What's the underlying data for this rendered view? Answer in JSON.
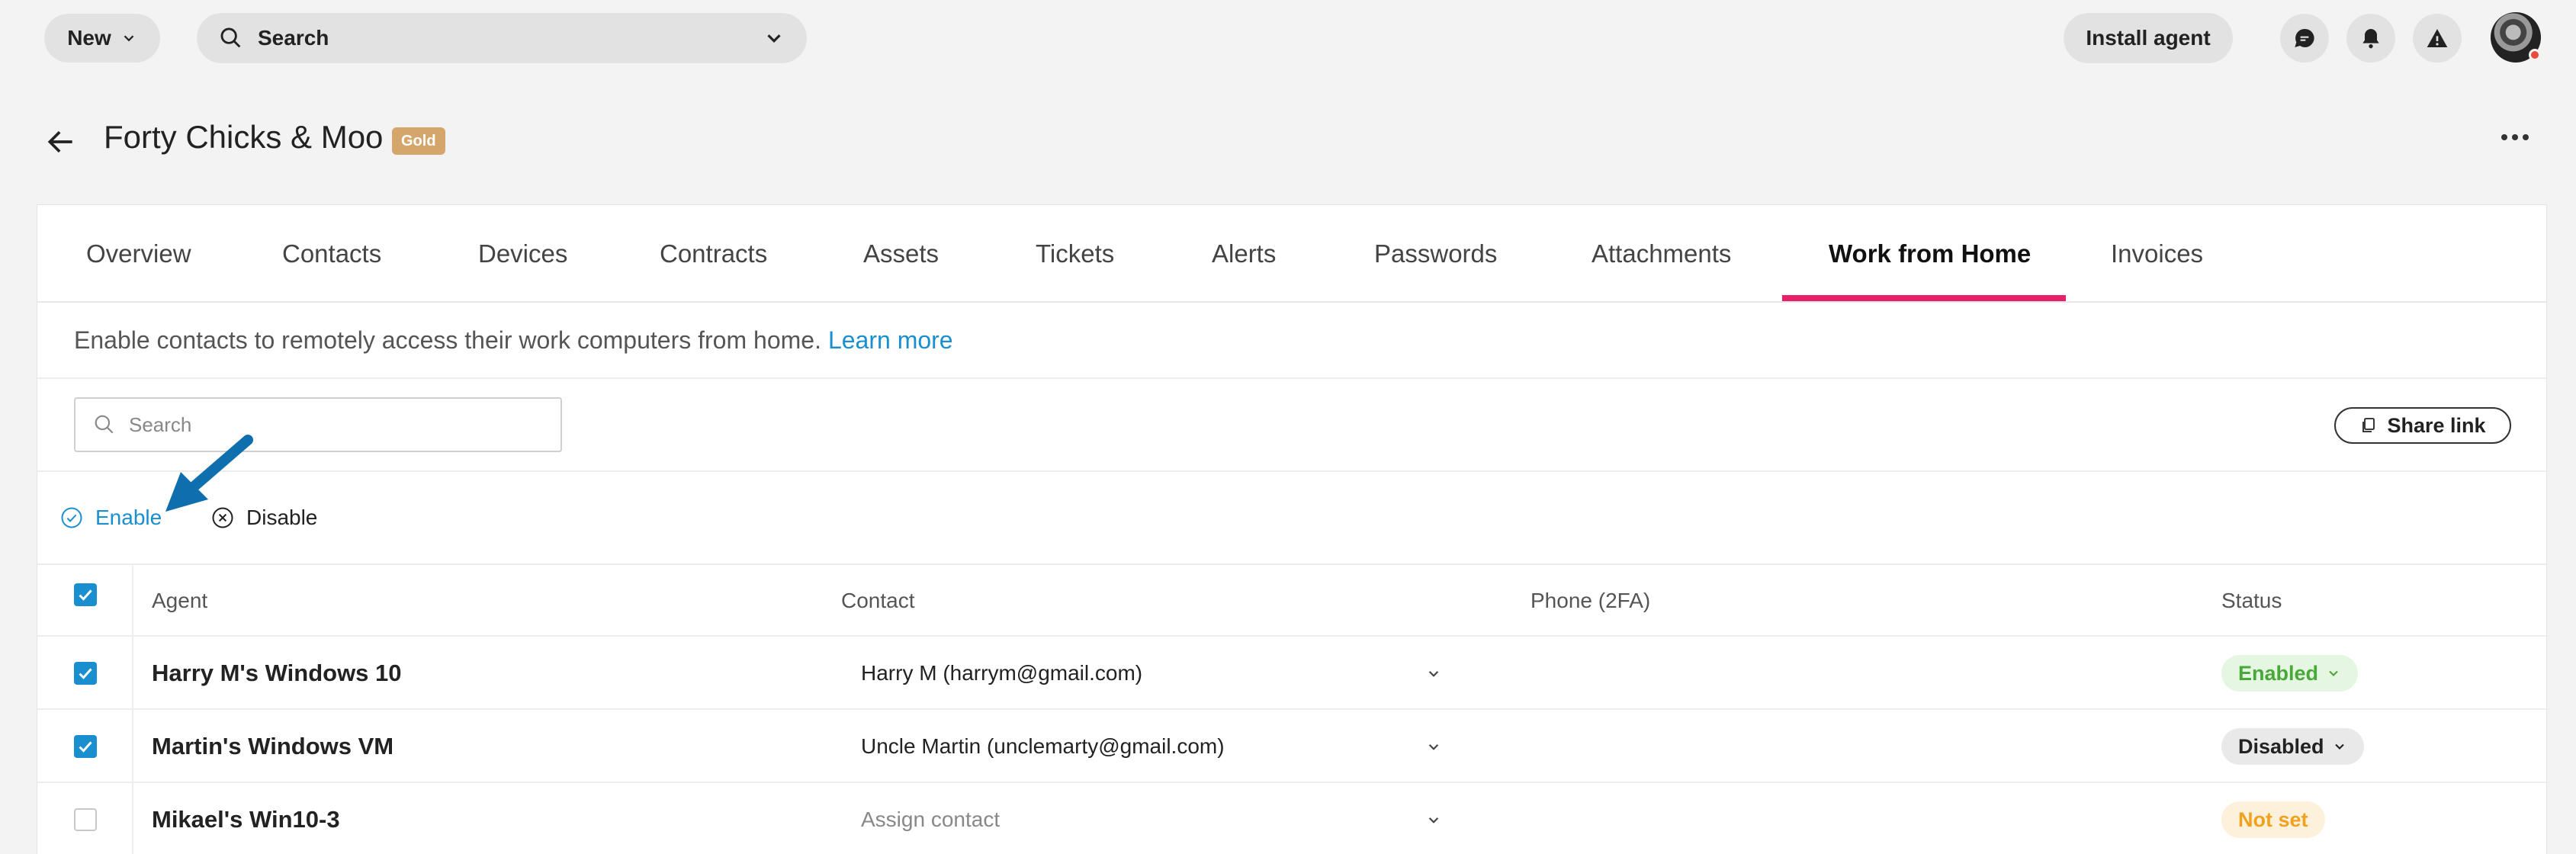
{
  "topbar": {
    "new_label": "New",
    "search_label": "Search",
    "install_label": "Install agent",
    "icons": [
      "chat-icon",
      "bell-icon",
      "warning-icon"
    ]
  },
  "page": {
    "title": "Forty Chicks & Moo",
    "badge": "Gold"
  },
  "tabs": [
    {
      "label": "Overview"
    },
    {
      "label": "Contacts"
    },
    {
      "label": "Devices"
    },
    {
      "label": "Contracts"
    },
    {
      "label": "Assets"
    },
    {
      "label": "Tickets"
    },
    {
      "label": "Alerts"
    },
    {
      "label": "Passwords"
    },
    {
      "label": "Attachments"
    },
    {
      "label": "Work from Home",
      "active": true
    },
    {
      "label": "Invoices"
    }
  ],
  "info": {
    "text": "Enable contacts to remotely access their work computers from home.",
    "link": "Learn more"
  },
  "search": {
    "placeholder": "Search",
    "share_label": "Share link"
  },
  "actions": {
    "enable_label": "Enable",
    "disable_label": "Disable"
  },
  "table": {
    "headers": {
      "agent": "Agent",
      "contact": "Contact",
      "phone": "Phone (2FA)",
      "status": "Status"
    },
    "header_checked": true,
    "rows": [
      {
        "checked": true,
        "agent": "Harry M's Windows 10",
        "contact": "Harry M (harrym@gmail.com)",
        "contact_placeholder": false,
        "status": "Enabled",
        "status_kind": "enabled"
      },
      {
        "checked": true,
        "agent": "Martin's Windows VM",
        "contact": "Uncle Martin (unclemarty@gmail.com)",
        "contact_placeholder": false,
        "status": "Disabled",
        "status_kind": "disabled"
      },
      {
        "checked": false,
        "agent": "Mikael's Win10-3",
        "contact": "Assign contact",
        "contact_placeholder": true,
        "status": "Not set",
        "status_kind": "notset"
      }
    ]
  },
  "colors": {
    "accent": "#1a8fd0",
    "tab_underline": "#e8206a",
    "badge_gold": "#d4a66b",
    "enabled": "#4aa83a",
    "notset": "#f0a21f"
  }
}
